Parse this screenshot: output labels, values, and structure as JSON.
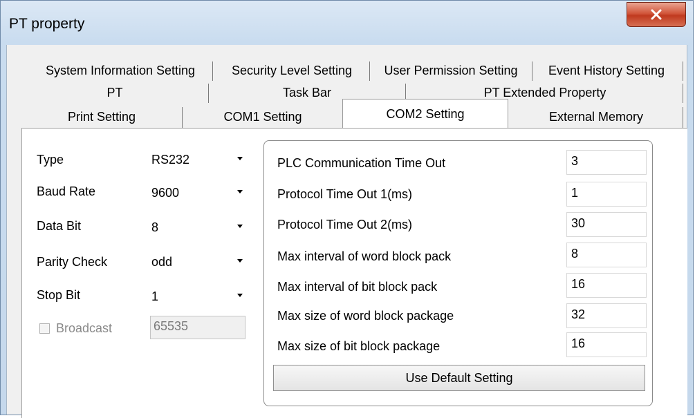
{
  "window": {
    "title": "PT property"
  },
  "tabs": {
    "row1": [
      "System Information Setting",
      "Security Level Setting",
      "User Permission Setting",
      "Event History Setting"
    ],
    "row2": [
      "PT",
      "Task Bar",
      "PT Extended Property"
    ],
    "row3": [
      "Print Setting",
      "COM1 Setting",
      "COM2 Setting",
      "External Memory"
    ],
    "active": "COM2 Setting"
  },
  "comm": {
    "type_label": "Type",
    "type_value": "RS232",
    "baud_label": "Baud Rate",
    "baud_value": "9600",
    "databit_label": "Data Bit",
    "databit_value": "8",
    "parity_label": "Parity Check",
    "parity_value": "odd",
    "stopbit_label": "Stop Bit",
    "stopbit_value": "1",
    "broadcast_label": "Broadcast",
    "broadcast_value": "65535"
  },
  "timeouts": [
    {
      "label": "PLC Communication Time Out",
      "value": "3"
    },
    {
      "label": "Protocol Time Out 1(ms)",
      "value": "1"
    },
    {
      "label": "Protocol Time Out 2(ms)",
      "value": "30"
    },
    {
      "label": "Max interval of word block pack",
      "value": "8"
    },
    {
      "label": "Max interval of bit block pack",
      "value": "16"
    },
    {
      "label": "Max size of word block package",
      "value": "32"
    },
    {
      "label": "Max size of bit block package",
      "value": "16"
    }
  ],
  "default_button": "Use Default Setting",
  "colors": {
    "accent": "#c03a1f",
    "panel": "#ffffff",
    "dialog": "#f0f0f0"
  }
}
